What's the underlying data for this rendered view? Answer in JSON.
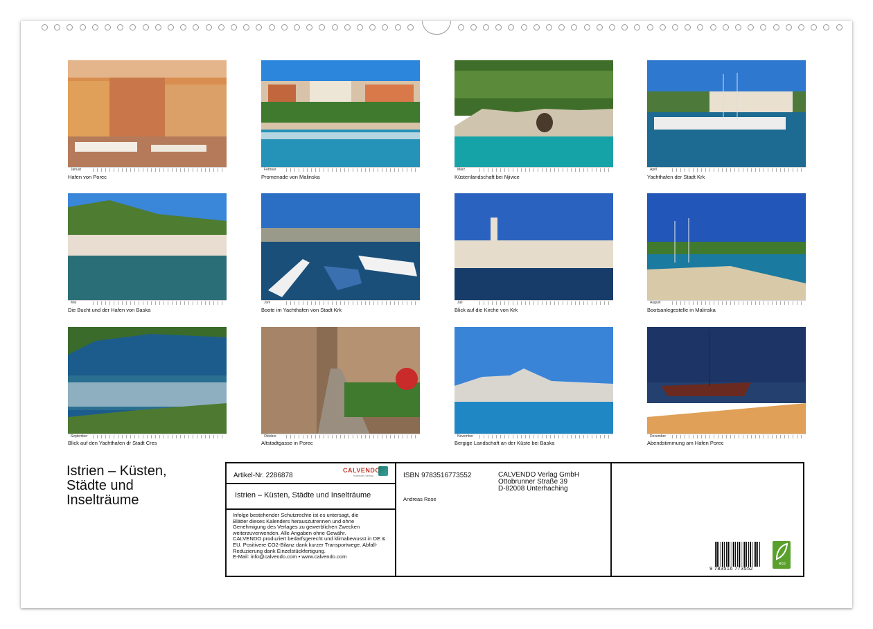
{
  "months": [
    {
      "label": "Januar",
      "caption": "Hafen von Porec"
    },
    {
      "label": "Februar",
      "caption": "Promenade von Malinska"
    },
    {
      "label": "März",
      "caption": "Küstenlandschaft bei Njivice"
    },
    {
      "label": "April",
      "caption": "Yachthafen der Stadt Krk"
    },
    {
      "label": "Mai",
      "caption": "Die Bucht und der Hafen von Baska"
    },
    {
      "label": "Juni",
      "caption": "Boote im Yachthafen von Stadt Krk"
    },
    {
      "label": "Juli",
      "caption": "Blick auf die Kirche von Krk"
    },
    {
      "label": "August",
      "caption": "Bootsanlegestelle in Malinska"
    },
    {
      "label": "September",
      "caption": "Blick auf den Yachthafen dr Stadt Cres"
    },
    {
      "label": "Oktober",
      "caption": "Altstadtgasse in Porec"
    },
    {
      "label": "November",
      "caption": "Bergige Landschaft an der Küste bei Baska"
    },
    {
      "label": "Dezember",
      "caption": "Abendstimmung am Hafen Porec"
    }
  ],
  "title_line1": "Istrien – Küsten,",
  "title_line2": "Städte und",
  "title_line3": "Inselträume",
  "info": {
    "article": "Artikel-Nr. 2286878",
    "brand": "CALVENDO",
    "brand_sub": "Kalender-Verlag",
    "product_title": "Istrien – Küsten, Städte und Inselträume",
    "legal": "Infolge bestehender Schutzrechte ist es untersagt, die\nBlätter dieses Kalenders herauszutrennen und ohne\nGenehmigung des Verlages zu gewerblichen Zwecken\nweiterzuverwenden. Alle Angaben ohne Gewähr.\nCALVENDO produziert bedarfsgerecht und klimabewusst in DE &\nEU. Positivere CO2-Bilanz dank kurzer Transportwege. Abfall-\nReduzierung dank Einzelstückfertigung.\nE-Mail: info@calvendo.com • www.calvendo.com",
    "isbn": "ISBN 9783516773552",
    "author": "Andreas Rose",
    "publisher1": "CALVENDO Verlag GmbH",
    "publisher2": "Ottobrunner Straße 39",
    "publisher3": "D-82008 Unterhaching",
    "barcode_digits": "9 783516 773552",
    "eco_label": "eco"
  },
  "palette": {
    "sky": "#2f7fd6",
    "sea": "#1f8fb0",
    "stone": "#d8b48a",
    "green": "#4c7a3a",
    "dusk": "#1b2f5a",
    "eco_green": "#5aa02c"
  }
}
